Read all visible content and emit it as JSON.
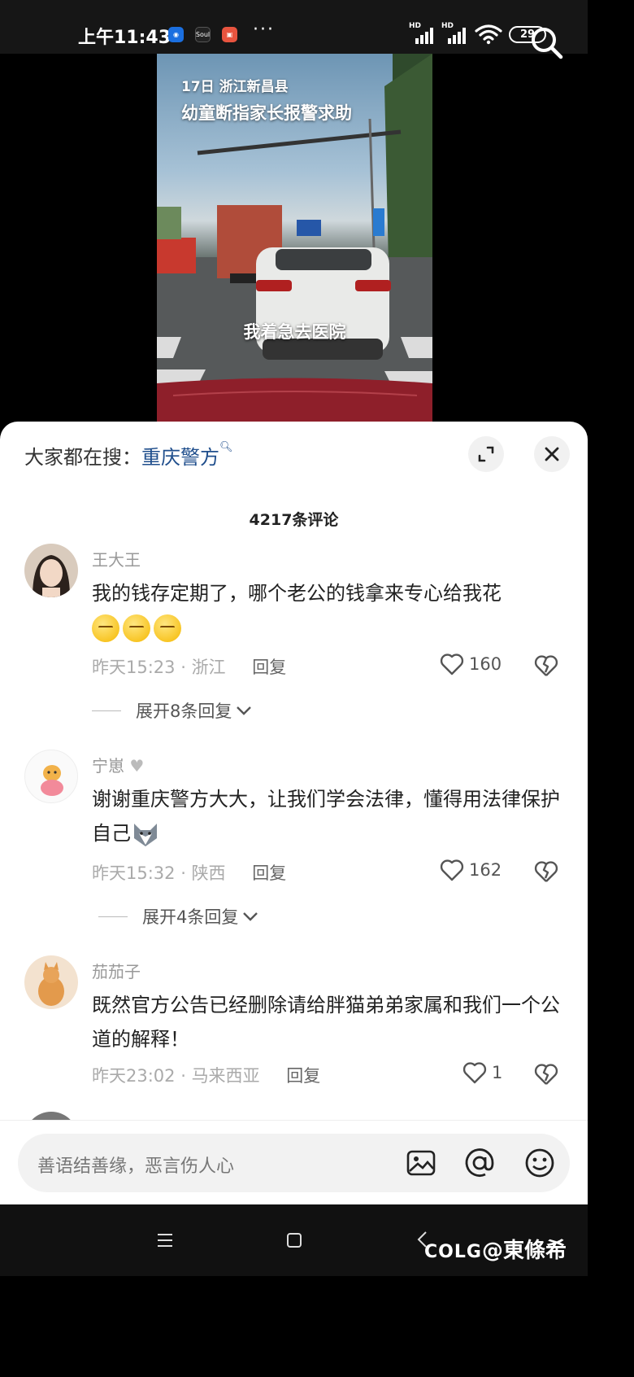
{
  "status_bar": {
    "time": "上午11:43",
    "apps": [
      "Soul"
    ],
    "more": "···",
    "signal_1": "HD",
    "signal_2": "HD",
    "battery": "29"
  },
  "video": {
    "caption_line1": "17日 浙江新昌县",
    "caption_line2": "幼童断指家长报警求助",
    "subtitle": "我着急去医院"
  },
  "sheet": {
    "trending_label": "大家都在搜：",
    "trending_keyword": "重庆警方",
    "comment_count": "4217条评论"
  },
  "comments": [
    {
      "user": "王大王",
      "text": "我的钱存定期了，哪个老公的钱拿来专心给我花",
      "time": "昨天15:23",
      "region": "浙江",
      "reply_label": "回复",
      "likes": "160",
      "expand_label": "展开8条回复"
    },
    {
      "user": "宁崽",
      "text": "谢谢重庆警方大大，让我们学会法律，懂得用法律保护自己",
      "time": "昨天15:32",
      "region": "陕西",
      "reply_label": "回复",
      "likes": "162",
      "expand_label": "展开4条回复"
    },
    {
      "user": "茄茄子",
      "text": "既然官方公告已经删除请给胖猫弟弟家属和我们一个公道的解释！",
      "time": "昨天23:02",
      "region": "马来西亚",
      "reply_label": "回复",
      "likes": "1"
    }
  ],
  "input": {
    "placeholder": "善语结善缘，恶言伤人心"
  },
  "watermark": "@東條希",
  "watermark_brand": "COLG",
  "icons": [
    "search-icon",
    "expand-icon",
    "close-icon",
    "heart-icon",
    "broken-heart-icon",
    "chevron-down-icon",
    "image-icon",
    "at-icon",
    "emoji-icon",
    "menu-icon",
    "home-icon",
    "back-icon"
  ]
}
